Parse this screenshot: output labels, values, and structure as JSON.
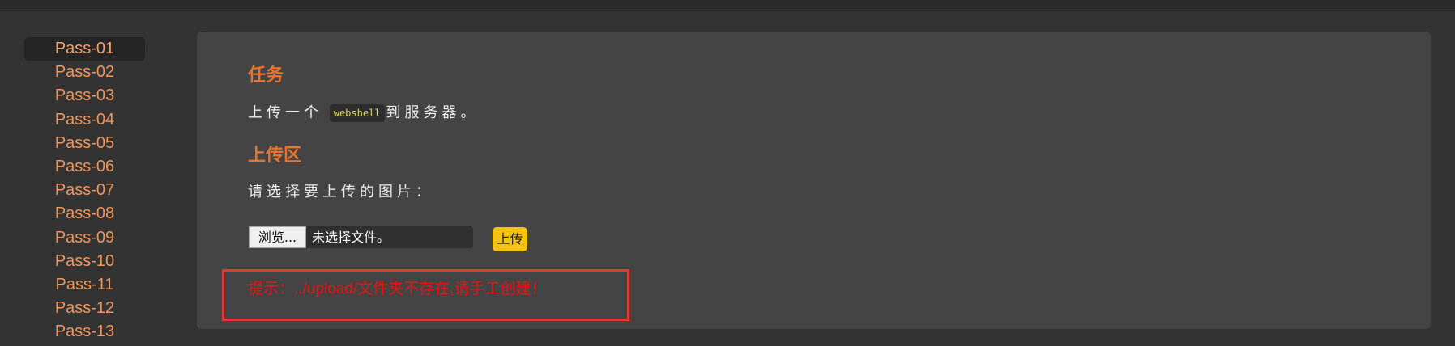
{
  "nav": {
    "items": [
      {
        "label": "Pass-01"
      },
      {
        "label": "Pass-02"
      },
      {
        "label": "Pass-03"
      },
      {
        "label": "Pass-04"
      },
      {
        "label": "Pass-05"
      },
      {
        "label": "Pass-06"
      },
      {
        "label": "Pass-07"
      },
      {
        "label": "Pass-08"
      },
      {
        "label": "Pass-09"
      },
      {
        "label": "Pass-10"
      },
      {
        "label": "Pass-11"
      },
      {
        "label": "Pass-12"
      },
      {
        "label": "Pass-13"
      }
    ],
    "active": "Pass-01"
  },
  "task": {
    "title": "任务",
    "text_before": "上传一个",
    "code": "webshell",
    "text_after": "到服务器。"
  },
  "upload": {
    "title": "上传区",
    "prompt": "请选择要上传的图片：",
    "browse_label": "浏览...",
    "file_status": "未选择文件。",
    "submit_label": "上传"
  },
  "warning": {
    "text": "提示：../upload/文件夹不存在,请手工创建！"
  },
  "colors": {
    "background": "#333333",
    "panel": "#444444",
    "accent_orange": "#e8722e",
    "nav_link": "#f0965b",
    "upload_button": "#f5c211",
    "warning_red": "#ee1111"
  }
}
